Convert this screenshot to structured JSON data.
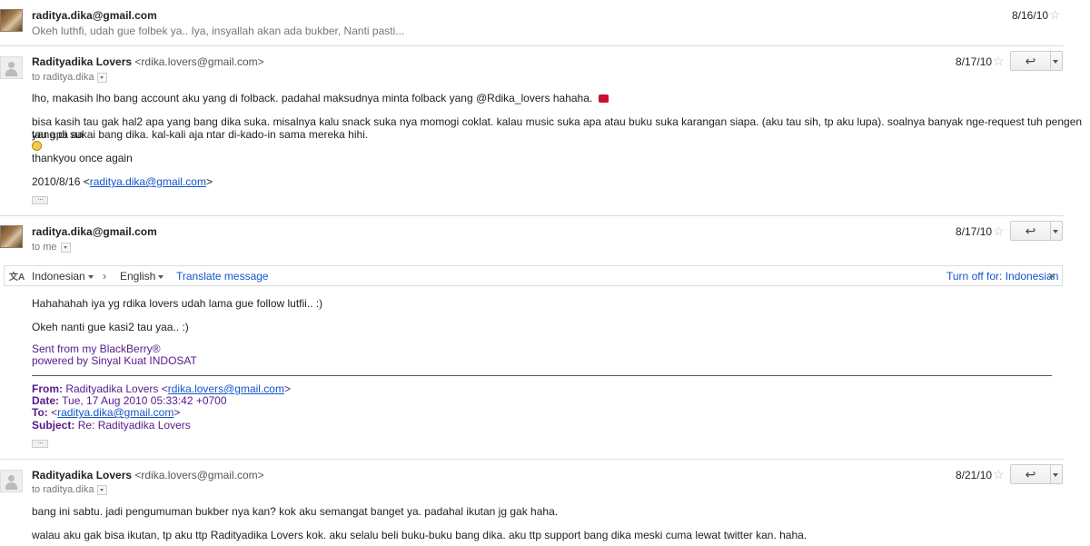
{
  "messages": [
    {
      "sender": "raditya.dika@gmail.com",
      "snippet": "Okeh luthfi, udah gue folbek ya.. Iya, insyallah akan ada bukber, Nanti pasti...",
      "date": "8/16/10"
    },
    {
      "sender": "Radityadika Lovers",
      "sender_email": "<rdika.lovers@gmail.com>",
      "to": "to raditya.dika",
      "date": "8/17/10",
      "body": [
        "lho, makasih lho bang account aku yang di folback. padahal maksudnya minta folback yang @Rdika_lovers hahaha.",
        "bisa kasih tau gak hal2 apa yang bang dika suka. misalnya kalu snack suka nya momogi coklat. kalau music suka apa atau buku suka karangan siapa. (aku tau sih, tp aku lupa). soalnya banyak nge-request tuh pengen tau apa aa",
        "yang di sukai bang dika. kal-kali aja ntar di-kado-in sama mereka hihi.",
        "thankyou once again"
      ],
      "quote_prefix": "2010/8/16 <",
      "quote_link": "raditya.dika@gmail.com",
      "quote_suffix": ">"
    },
    {
      "sender": "raditya.dika@gmail.com",
      "to": "to me",
      "date": "8/17/10",
      "body": [
        "Hahahahah iya yg rdika lovers udah lama gue follow lutfii.. :)",
        "Okeh nanti gue kasi2 tau yaa.. :)"
      ],
      "signature": [
        "Sent from my BlackBerry®",
        "powered by Sinyal Kuat INDOSAT"
      ],
      "quoted": {
        "from_label": "From:",
        "from_name": "Radityadika Lovers <",
        "from_link": "rdika.lovers@gmail.com",
        "from_close": ">",
        "date_label": "Date:",
        "date_value": "Tue, 17 Aug 2010 05:33:42 +0700",
        "to_label": "To:",
        "to_open": "<",
        "to_link": "raditya.dika@gmail.com",
        "to_close": ">",
        "subject_label": "Subject:",
        "subject_value": "Re: Radityadika Lovers"
      }
    },
    {
      "sender": "Radityadika Lovers",
      "sender_email": "<rdika.lovers@gmail.com>",
      "to": "to raditya.dika",
      "date": "8/21/10",
      "body": [
        "bang ini sabtu. jadi pengumuman bukber nya kan? kok aku semangat banget ya. padahal ikutan jg gak haha.",
        "walau aku gak bisa ikutan, tp aku ttp Radityadika Lovers kok. aku selalu beli buku-buku bang dika. aku ttp support bang dika meski cuma lewat twitter kan. haha."
      ]
    }
  ],
  "translate_bar": {
    "source_lang": "Indonesian",
    "arrow": "›",
    "target_lang": "English",
    "translate_link": "Translate message",
    "turn_off": "Turn off for: Indonesian",
    "close": "×"
  },
  "ellipsis": "···",
  "reply_icon": "↩",
  "star_icon": "☆",
  "translate_icon": "文A",
  "colors": {
    "link": "#1155cc",
    "signature": "#551a8b"
  }
}
